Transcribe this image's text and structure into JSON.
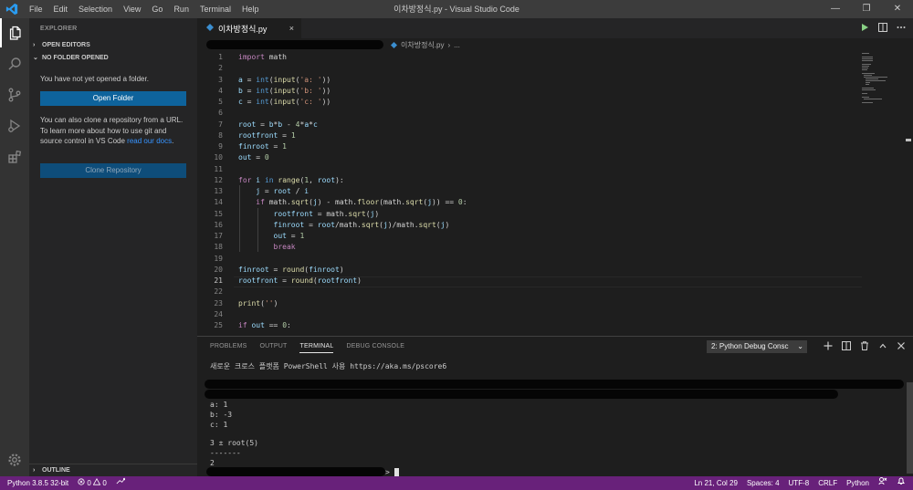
{
  "window": {
    "title": "이차방정식.py - Visual Studio Code",
    "menu": [
      "File",
      "Edit",
      "Selection",
      "View",
      "Go",
      "Run",
      "Terminal",
      "Help"
    ],
    "controls": [
      "—",
      "❐",
      "✕"
    ]
  },
  "activity_bar": {
    "items": [
      "explorer-icon",
      "search-icon",
      "source-control-icon",
      "run-debug-icon",
      "extensions-icon"
    ],
    "bottom": "settings-gear-icon",
    "active": "explorer-icon",
    "accent_color": "#ffffff"
  },
  "sidebar": {
    "title": "EXPLORER",
    "open_editors": "OPEN EDITORS",
    "no_folder": "NO FOLDER OPENED",
    "message": "You have not yet opened a folder.",
    "open_folder_button": "Open Folder",
    "clone_text": "You can also clone a repository from a URL. To learn more about how to use git and source control in VS Code ",
    "clone_link_1": "read our",
    "clone_link_2": "docs",
    "clone_text_end": ".",
    "clone_button": "Clone Repository",
    "outline": "OUTLINE"
  },
  "editor": {
    "tab_label": "이차방정식.py",
    "tab_close": "×",
    "breadcrumb_file": "이차방정식.py",
    "breadcrumb_more": "...",
    "language_color": "#3b8ed0",
    "active_line": 21
  },
  "code": [
    {
      "n": "1",
      "segs": [
        [
          "kw-p",
          "import"
        ],
        [
          "",
          " math"
        ]
      ]
    },
    {
      "n": "2",
      "segs": []
    },
    {
      "n": "3",
      "segs": [
        [
          "var",
          "a"
        ],
        [
          "",
          " = "
        ],
        [
          "kw-b",
          "int"
        ],
        [
          "",
          "("
        ],
        [
          "fn",
          "input"
        ],
        [
          "",
          "("
        ],
        [
          "str",
          "'a: '"
        ],
        [
          "",
          "))"
        ]
      ]
    },
    {
      "n": "4",
      "segs": [
        [
          "var",
          "b"
        ],
        [
          "",
          " = "
        ],
        [
          "kw-b",
          "int"
        ],
        [
          "",
          "("
        ],
        [
          "fn",
          "input"
        ],
        [
          "",
          "("
        ],
        [
          "str",
          "'b: '"
        ],
        [
          "",
          "))"
        ]
      ]
    },
    {
      "n": "5",
      "segs": [
        [
          "var",
          "c"
        ],
        [
          "",
          " = "
        ],
        [
          "kw-b",
          "int"
        ],
        [
          "",
          "("
        ],
        [
          "fn",
          "input"
        ],
        [
          "",
          "("
        ],
        [
          "str",
          "'c: '"
        ],
        [
          "",
          "))"
        ]
      ]
    },
    {
      "n": "6",
      "segs": []
    },
    {
      "n": "7",
      "segs": [
        [
          "var",
          "root"
        ],
        [
          "",
          " = "
        ],
        [
          "var",
          "b"
        ],
        [
          "",
          "*"
        ],
        [
          "var",
          "b"
        ],
        [
          "",
          " - "
        ],
        [
          "num",
          "4"
        ],
        [
          "",
          "*"
        ],
        [
          "var",
          "a"
        ],
        [
          "",
          "*"
        ],
        [
          "var",
          "c"
        ]
      ]
    },
    {
      "n": "8",
      "segs": [
        [
          "var",
          "rootfront"
        ],
        [
          "",
          " = "
        ],
        [
          "num",
          "1"
        ]
      ]
    },
    {
      "n": "9",
      "segs": [
        [
          "var",
          "finroot"
        ],
        [
          "",
          " = "
        ],
        [
          "num",
          "1"
        ]
      ]
    },
    {
      "n": "10",
      "segs": [
        [
          "var",
          "out"
        ],
        [
          "",
          " = "
        ],
        [
          "num",
          "0"
        ]
      ]
    },
    {
      "n": "11",
      "segs": []
    },
    {
      "n": "12",
      "segs": [
        [
          "kw-p",
          "for"
        ],
        [
          "",
          " "
        ],
        [
          "var",
          "i"
        ],
        [
          "",
          " "
        ],
        [
          "kw-b",
          "in"
        ],
        [
          "",
          " "
        ],
        [
          "fn",
          "range"
        ],
        [
          "",
          "("
        ],
        [
          "num",
          "1"
        ],
        [
          "",
          ", "
        ],
        [
          "var",
          "root"
        ],
        [
          "",
          "):"
        ]
      ]
    },
    {
      "n": "13",
      "segs": [
        [
          "",
          "    "
        ],
        [
          "var",
          "j"
        ],
        [
          "",
          " = "
        ],
        [
          "var",
          "root"
        ],
        [
          "",
          " / "
        ],
        [
          "var",
          "i"
        ]
      ]
    },
    {
      "n": "14",
      "segs": [
        [
          "",
          "    "
        ],
        [
          "kw-p",
          "if"
        ],
        [
          "",
          " math."
        ],
        [
          "fn",
          "sqrt"
        ],
        [
          "",
          "("
        ],
        [
          "var",
          "j"
        ],
        [
          "",
          ") - math."
        ],
        [
          "fn",
          "floor"
        ],
        [
          "",
          "(math."
        ],
        [
          "fn",
          "sqrt"
        ],
        [
          "",
          "("
        ],
        [
          "var",
          "j"
        ],
        [
          "",
          ")) == "
        ],
        [
          "num",
          "0"
        ],
        [
          "",
          ":"
        ]
      ]
    },
    {
      "n": "15",
      "segs": [
        [
          "",
          "        "
        ],
        [
          "var",
          "rootfront"
        ],
        [
          "",
          " = math."
        ],
        [
          "fn",
          "sqrt"
        ],
        [
          "",
          "("
        ],
        [
          "var",
          "j"
        ],
        [
          "",
          ")"
        ]
      ]
    },
    {
      "n": "16",
      "segs": [
        [
          "",
          "        "
        ],
        [
          "var",
          "finroot"
        ],
        [
          "",
          " = "
        ],
        [
          "var",
          "root"
        ],
        [
          "",
          "/math."
        ],
        [
          "fn",
          "sqrt"
        ],
        [
          "",
          "("
        ],
        [
          "var",
          "j"
        ],
        [
          "",
          ")/math."
        ],
        [
          "fn",
          "sqrt"
        ],
        [
          "",
          "("
        ],
        [
          "var",
          "j"
        ],
        [
          "",
          ")"
        ]
      ]
    },
    {
      "n": "17",
      "segs": [
        [
          "",
          "        "
        ],
        [
          "var",
          "out"
        ],
        [
          "",
          " = "
        ],
        [
          "num",
          "1"
        ]
      ]
    },
    {
      "n": "18",
      "segs": [
        [
          "",
          "        "
        ],
        [
          "kw-p",
          "break"
        ]
      ]
    },
    {
      "n": "19",
      "segs": []
    },
    {
      "n": "20",
      "segs": [
        [
          "var",
          "finroot"
        ],
        [
          "",
          " = "
        ],
        [
          "fn",
          "round"
        ],
        [
          "",
          "("
        ],
        [
          "var",
          "finroot"
        ],
        [
          "",
          ")"
        ]
      ]
    },
    {
      "n": "21",
      "segs": [
        [
          "var",
          "rootfront"
        ],
        [
          "",
          " = "
        ],
        [
          "fn",
          "round"
        ],
        [
          "",
          "("
        ],
        [
          "var",
          "rootfront"
        ],
        [
          "",
          ")"
        ]
      ]
    },
    {
      "n": "22",
      "segs": []
    },
    {
      "n": "23",
      "segs": [
        [
          "fn",
          "print"
        ],
        [
          "",
          "("
        ],
        [
          "str",
          "''"
        ],
        [
          "",
          ")"
        ]
      ]
    },
    {
      "n": "24",
      "segs": []
    },
    {
      "n": "25",
      "segs": [
        [
          "kw-p",
          "if"
        ],
        [
          "",
          " "
        ],
        [
          "var",
          "out"
        ],
        [
          "",
          " == "
        ],
        [
          "num",
          "0"
        ],
        [
          "",
          ":"
        ]
      ]
    }
  ],
  "panel": {
    "tabs": [
      "PROBLEMS",
      "OUTPUT",
      "TERMINAL",
      "DEBUG CONSOLE"
    ],
    "active_tab": "TERMINAL",
    "terminal_select": "2: Python Debug Consc",
    "terminal_lines": [
      "새로운 크로스 플랫폼 PowerShell 사용 https://aka.ms/pscore6",
      "a: 1",
      "b: -3",
      "c: 1",
      "3 ± root(5)",
      "-------",
      "2"
    ],
    "prompt_suffix": ">"
  },
  "status": {
    "interpreter": "Python 3.8.5 32-bit",
    "errors": "0",
    "warnings": "0",
    "position": "Ln 21, Col 29",
    "spaces": "Spaces: 4",
    "encoding": "UTF-8",
    "eol": "CRLF",
    "language": "Python",
    "bar_color": "#68217a"
  }
}
